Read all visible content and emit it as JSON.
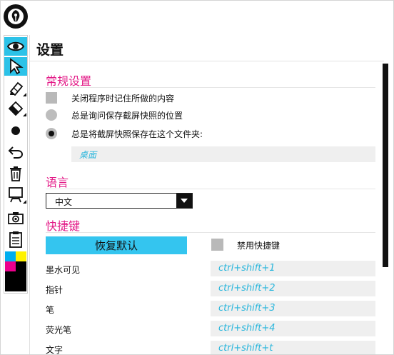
{
  "window": {
    "title": "设置"
  },
  "toolbar": {
    "tools": [
      {
        "icon": "eye-icon",
        "active": true
      },
      {
        "icon": "pointer-icon",
        "active": true
      },
      {
        "icon": "marker-icon",
        "active": false
      },
      {
        "icon": "eraser-icon",
        "active": false
      },
      {
        "icon": "dot-icon",
        "active": false
      },
      {
        "icon": "undo-icon",
        "active": false
      },
      {
        "icon": "trash-icon",
        "active": false
      },
      {
        "icon": "whiteboard-icon",
        "active": false
      },
      {
        "icon": "camera-icon",
        "active": false
      },
      {
        "icon": "clipboard-icon",
        "active": false
      }
    ],
    "palette": [
      "#00aeef",
      "#fff200",
      "#ec008c",
      "#000000"
    ]
  },
  "general": {
    "header": "常规设置",
    "clear_on_close": "关闭程序时记住所做的内容",
    "ask_location": "总是询问保存截屏快照的位置",
    "save_to_folder": "总是将截屏快照保存在这个文件夹:",
    "folder_value": "桌面"
  },
  "language": {
    "header": "语言",
    "selected": "中文"
  },
  "hotkeys": {
    "header": "快捷键",
    "reset_label": "恢复默认",
    "disable_label": "禁用快捷键",
    "rows": [
      {
        "name": "墨水可见",
        "key": "ctrl+shift+1"
      },
      {
        "name": "指针",
        "key": "ctrl+shift+2"
      },
      {
        "name": "笔",
        "key": "ctrl+shift+3"
      },
      {
        "name": "荧光笔",
        "key": "ctrl+shift+4"
      },
      {
        "name": "文字",
        "key": "ctrl+shift+t"
      }
    ]
  },
  "colors": {
    "accent": "#2cc2e8",
    "section_header": "#e31c88",
    "key_text": "#2ab6dc"
  }
}
